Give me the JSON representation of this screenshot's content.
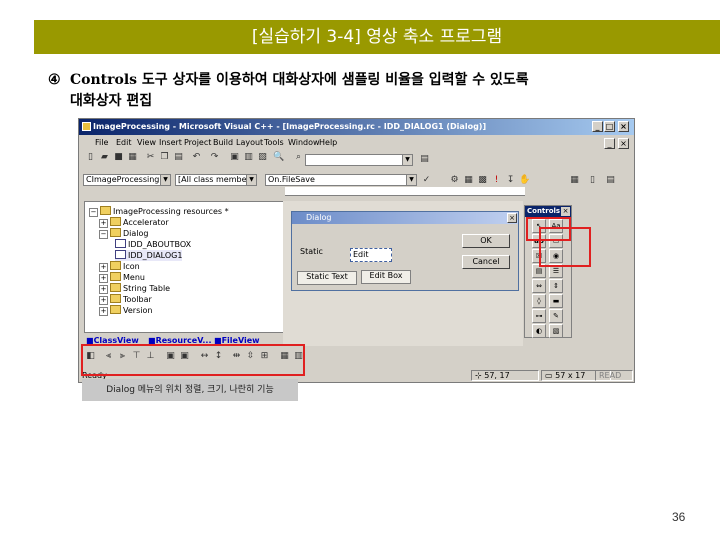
{
  "slide": {
    "title": "[실습하기 3-4] 영상 축소 프로그램",
    "step_marker": "④",
    "step_line1": "Controls 도구 상자를 이용하여 대화상자에 샘플링 비율을 입력할 수 있도록",
    "step_line2": "대화상자 편집",
    "caption": "Dialog 메뉴의 위치 정렬, 크기, 나란히 기능",
    "page_number": "36"
  },
  "window": {
    "title": "ImageProcessing - Microsoft Visual C++ - [ImageProcessing.rc - IDD_DIALOG1 (Dialog)]",
    "menus": [
      "File",
      "Edit",
      "View",
      "Insert",
      "Project",
      "Build",
      "Layout",
      "Tools",
      "Window",
      "Help"
    ],
    "class_combo": "CImageProcessingI",
    "members_combo": "[All class members",
    "function_combo": "On.FileSave",
    "tree": {
      "root": "ImageProcessing resources *",
      "accelerator": "Accelerator",
      "dialog": "Dialog",
      "aboutbox": "IDD_ABOUTBOX",
      "dialog1": "IDD_DIALOG1",
      "icon": "Icon",
      "menu": "Menu",
      "string_table": "String Table",
      "toolbar": "Toolbar",
      "version": "Version"
    },
    "tabs": [
      "ClassView",
      "ResourceV...",
      "FileView"
    ],
    "dialog_editor": {
      "title": "Dialog",
      "static_label": "Static",
      "edit_label": "Edit",
      "ok": "OK",
      "cancel": "Cancel",
      "static_tooltip": "Static Text",
      "edit_tooltip": "Edit Box"
    },
    "palette_title": "Controls",
    "status": {
      "ready": "Ready",
      "position": "57, 17",
      "size": "57 x 17",
      "read": "READ"
    }
  },
  "colors": {
    "title_bar": "#999900",
    "highlight": "#e02020",
    "titlebar_start": "#0a246a"
  }
}
